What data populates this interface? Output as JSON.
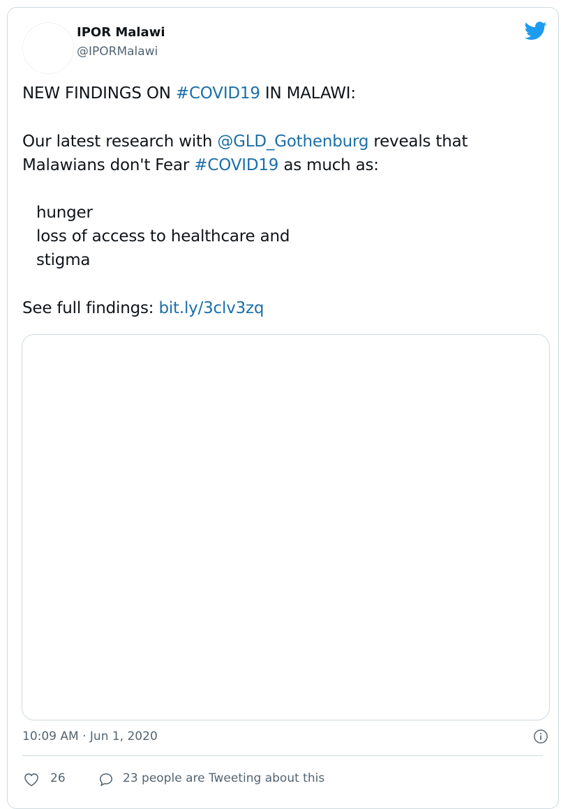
{
  "author": {
    "name": "IPOR Malawi",
    "handle": "@IPORMalawi"
  },
  "tweet": {
    "line1": {
      "before": "NEW FINDINGS ON ",
      "hashtag": "#COVID19",
      "after": " IN MALAWI:"
    },
    "line2": {
      "before": "Our latest research with ",
      "mention": "@GLD_Gothenburg",
      "after": " reveals that"
    },
    "line3": {
      "before": "Malawians don't Fear ",
      "hashtag": "#COVID19",
      "after": " as much as:"
    },
    "list": [
      "hunger",
      "loss of access to healthcare and",
      "stigma"
    ],
    "findings": {
      "before": "See full findings: ",
      "link": "bit.ly/3clv3zq"
    }
  },
  "meta": {
    "timestamp": "10:09 AM · Jun 1, 2020"
  },
  "actions": {
    "like_count": "26",
    "reply_text": "23 people are Tweeting about this"
  },
  "colors": {
    "link": "#1b6fa8",
    "twitter_blue": "#1d9bf0",
    "muted": "#536471",
    "border": "#cfd9de"
  }
}
